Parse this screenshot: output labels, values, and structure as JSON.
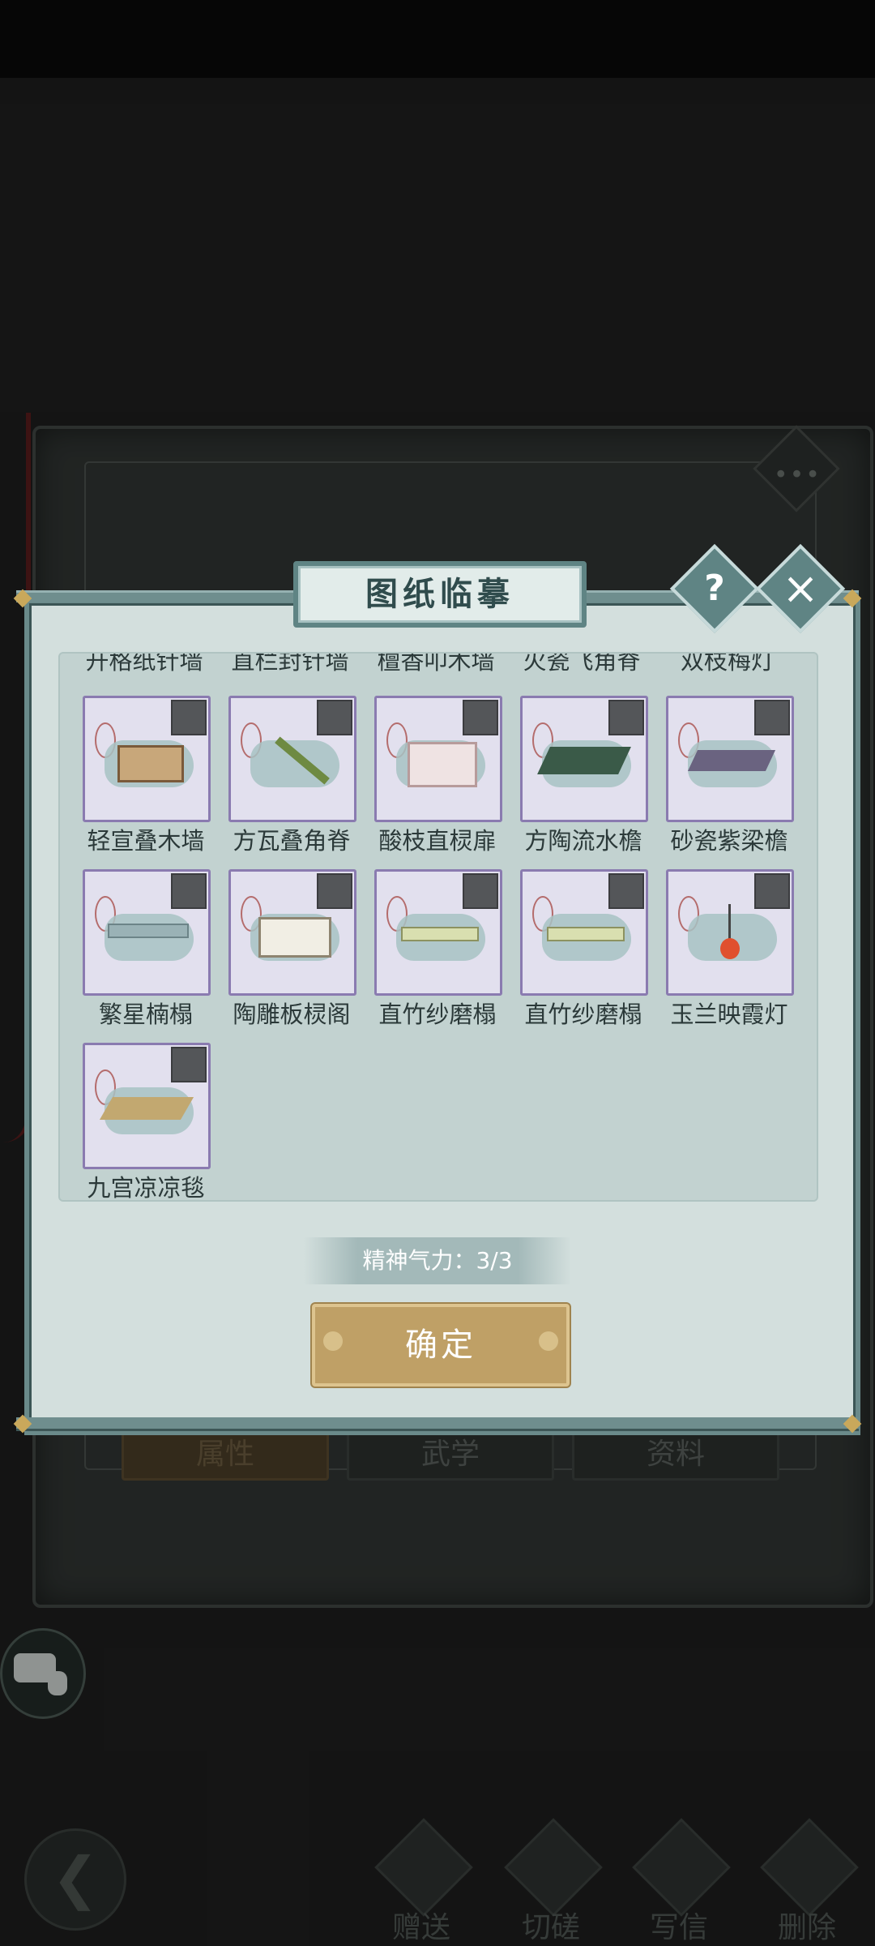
{
  "modal": {
    "title": "图纸临摹",
    "help_symbol": "?",
    "close_symbol": "×",
    "clipped_row": [
      "开格纸针墙",
      "直栏封针墙",
      "檀香叩木墙",
      "火瓷飞角脊",
      "双枝梅灯"
    ],
    "rows": [
      [
        "轻宣叠木墙",
        "方瓦叠角脊",
        "酸枝直棂扉",
        "方陶流水檐",
        "砂瓷紫梁檐"
      ],
      [
        "繁星楠榻",
        "陶雕板棂阁",
        "直竹纱磨榻",
        "直竹纱磨榻",
        "玉兰映霞灯"
      ],
      [
        "九宫凉凉毯"
      ]
    ],
    "stamina_text": "精神气力：3/3",
    "confirm_label": "确定"
  },
  "background": {
    "tabs": [
      "属性",
      "武学",
      "资料"
    ],
    "menu_dots": "•••",
    "actions": [
      "赠送",
      "切磋",
      "写信",
      "删除"
    ],
    "back_symbol": "❮"
  },
  "colors": {
    "modal_bg": "#d3dfdd",
    "frame": "#6a8a8a",
    "confirm": "#bfa066",
    "card_border": "#8a7bb0"
  }
}
